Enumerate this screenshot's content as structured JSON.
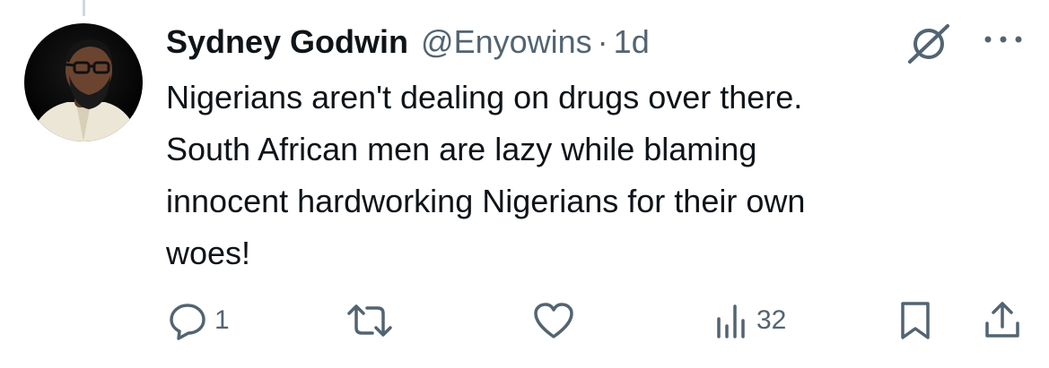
{
  "tweet": {
    "author": {
      "display_name": "Sydney Godwin",
      "handle": "@Enyowins",
      "avatar_icon": "profile-photo"
    },
    "separator": "·",
    "timestamp": "1d",
    "text": "Nigerians aren't dealing on drugs over there.\nSouth African men are lazy while blaming\ninnocent hardworking Nigerians for their own\nwoes!",
    "actions": {
      "reply": {
        "icon": "reply-icon",
        "count": "1"
      },
      "retweet": {
        "icon": "retweet-icon",
        "count": ""
      },
      "like": {
        "icon": "heart-icon",
        "count": ""
      },
      "views": {
        "icon": "views-icon",
        "count": "32"
      },
      "bookmark": {
        "icon": "bookmark-icon"
      },
      "share": {
        "icon": "share-icon"
      }
    },
    "header_icons": [
      "grok-icon",
      "more-icon"
    ]
  },
  "colors": {
    "text_primary": "#0f1419",
    "text_secondary": "#536471",
    "thread_line": "#cfd9de",
    "background": "#ffffff"
  }
}
